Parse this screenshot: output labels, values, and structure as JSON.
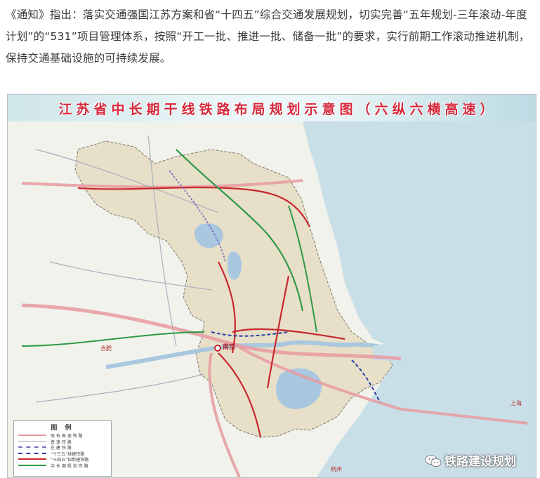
{
  "intro": {
    "text": "《通知》指出：落实交通强国江苏方案和省“十四五”综合交通发展规划，切实完善“五年规划-三年滚动-年度计划”的“531”项目管理体系，按照“开工一批、推进一批、储备一批”的要求，实行前期工作滚动推进机制，保持交通基础设施的可持续发展。"
  },
  "map": {
    "title": "江苏省中长期干线铁路布局规划示意图（六纵六横高速）",
    "cities": {
      "nanjing": "南京",
      "shanghai": "上海",
      "hefei": "合肥",
      "hangzhou": "杭州"
    },
    "legend": {
      "title": "图 例",
      "items": [
        {
          "label": "既 有 高 速 铁 路",
          "color": "#e89aa0",
          "style": "solid"
        },
        {
          "label": "普 速 铁 路",
          "color": "#9aa4b4",
          "style": "solid"
        },
        {
          "label": "在 建 铁 路",
          "color": "#7a6cc0",
          "style": "dashed"
        },
        {
          "label": "“十三五”续建铁路",
          "color": "#2a3ea8",
          "style": "dashed"
        },
        {
          "label": "“十四五”拟新建铁路",
          "color": "#c8282e",
          "style": "solid"
        },
        {
          "label": "中 长 期 规 划 铁 路",
          "color": "#2e9a48",
          "style": "solid"
        }
      ]
    },
    "colors": {
      "land_jiangsu": "#e9e1cc",
      "land_other": "#f2f3ef",
      "sea": "#c6dde6",
      "lake": "#a9c7de"
    }
  },
  "watermark": {
    "text": "铁路建设规划"
  }
}
